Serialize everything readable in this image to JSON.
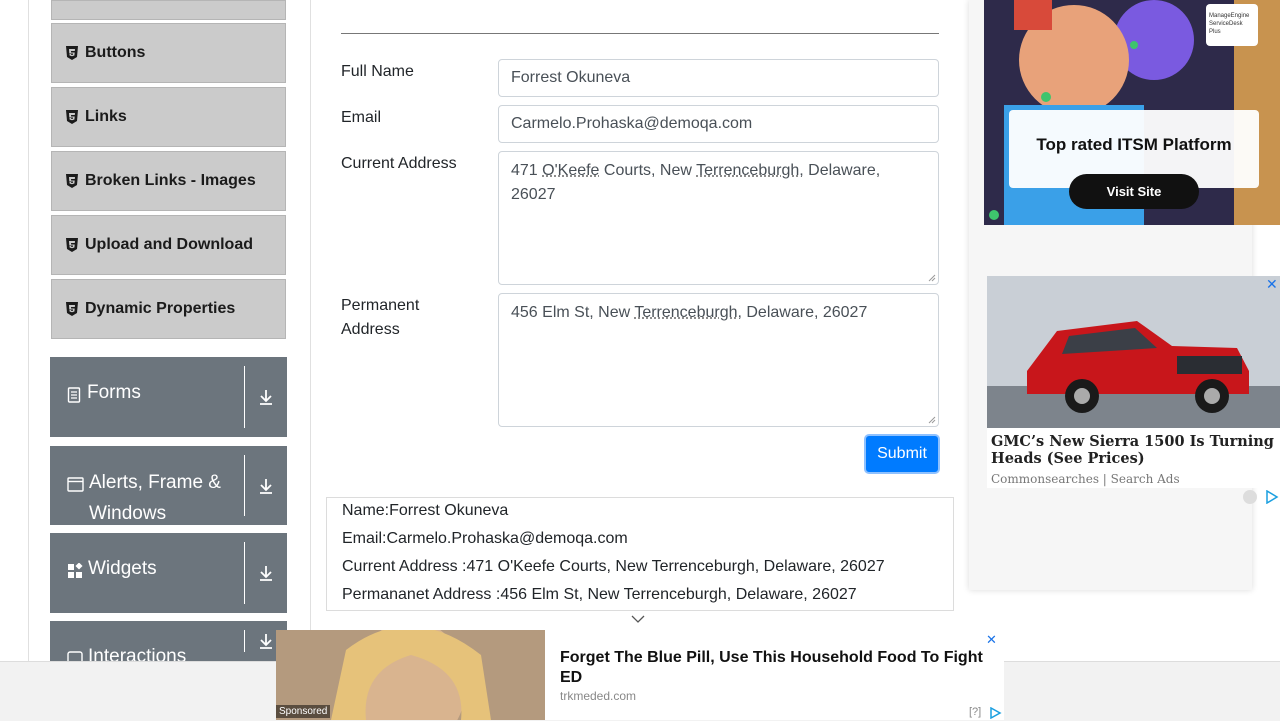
{
  "sidebar": {
    "sub_items": [
      {
        "label": "Buttons"
      },
      {
        "label": "Links"
      },
      {
        "label": "Broken Links - Images"
      },
      {
        "label": "Upload and Download"
      },
      {
        "label": "Dynamic Properties"
      }
    ],
    "groups": [
      {
        "label": "Forms"
      },
      {
        "label": "Alerts, Frame &",
        "label2": "Windows"
      },
      {
        "label": "Widgets"
      },
      {
        "label": "Interactions"
      }
    ]
  },
  "form": {
    "full_name_label": "Full Name",
    "full_name_value": "Forrest Okuneva",
    "email_label": "Email",
    "email_value": "Carmelo.Prohaska@demoqa.com",
    "current_address_label": "Current Address",
    "current_address_parts": [
      "471 ",
      "O'Keefe",
      " Courts, New ",
      "Terrenceburgh",
      ", Delaware,",
      "26027"
    ],
    "permanent_address_label_1": "Permanent",
    "permanent_address_label_2": "Address",
    "permanent_address_parts": [
      "456 Elm St, New ",
      "Terrenceburgh",
      ", Delaware, 26027"
    ],
    "submit_label": "Submit"
  },
  "output": {
    "name": "Name:Forrest Okuneva",
    "email": "Email:Carmelo.Prohaska@demoqa.com",
    "current": "Current Address :471 O'Keefe Courts, New Terrenceburgh, Delaware, 26027",
    "permanent": "Permananet Address :456 Elm St, New Terrenceburgh, Delaware, 26027"
  },
  "ads": {
    "itsm_brand": "ManageEngine ServiceDesk Plus",
    "itsm_headline": "Top rated ITSM Platform",
    "itsm_cta": "Visit Site",
    "car_headline": "GMC’s New Sierra 1500 Is Turning Heads (See Prices)",
    "car_source": "Commonsearches | Search Ads",
    "bottom_headline": "Forget The Blue Pill, Use This Household Food To Fight ED",
    "bottom_domain": "trkmeded.com",
    "bottom_sponsored": "Sponsored",
    "bottom_help": "[?]"
  },
  "colors": {
    "sidebar_group_bg": "#6c757d",
    "sidebar_item_bg": "#cbcbcb",
    "submit_bg": "#007bff"
  }
}
